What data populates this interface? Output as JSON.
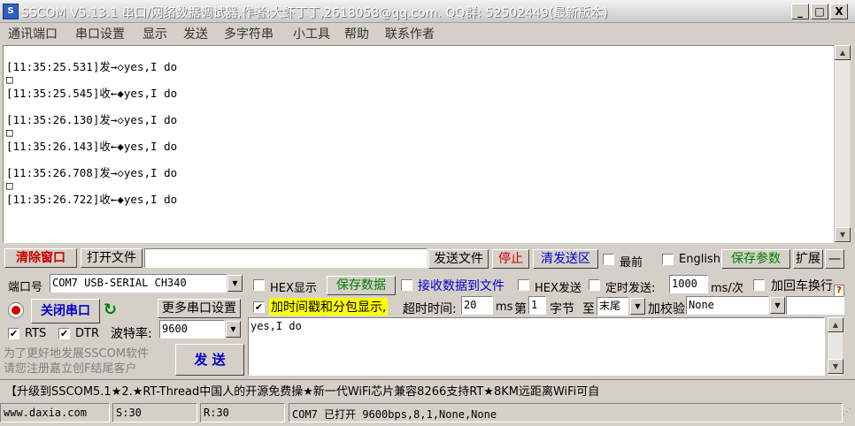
{
  "window": {
    "title": "SSCOM V5.13.1 串口/网络数据调试器,作者:大虾丁丁,2618058@qq.com. QQ群: 52502449(最新版本)",
    "minimize": "_",
    "maximize": "□",
    "close": "X"
  },
  "menu": [
    "通讯端口",
    "串口设置",
    "显示",
    "发送",
    "多字符串",
    "小工具",
    "帮助",
    "联系作者"
  ],
  "receive_log": [
    "[11:35:25.531]发→◇yes,I do",
    "□",
    "[11:35:25.545]收←◆yes,I do",
    "[11:35:26.130]发→◇yes,I do",
    "□",
    "[11:35:26.143]收←◆yes,I do",
    "[11:35:26.708]发→◇yes,I do",
    "□",
    "[11:35:26.722]收←◆yes,I do"
  ],
  "toolbar": {
    "clear_window": "清除窗口",
    "open_file": "打开文件",
    "file_path": "",
    "send_file": "发送文件",
    "stop": "停止",
    "clear_send": "清发送区",
    "topmost": "最前",
    "english": "English",
    "save_params": "保存参数",
    "expand": "扩展",
    "collapse": "—"
  },
  "port": {
    "label": "端口号",
    "value": "COM7 USB-SERIAL CH340",
    "close_port": "关闭串口",
    "more_settings": "更多串口设置",
    "rts": "RTS",
    "dtr": "DTR",
    "baud_label": "波特率:",
    "baud_value": "9600"
  },
  "options": {
    "hex_display": "HEX显示",
    "save_data": "保存数据",
    "recv_to_file": "接收数据到文件",
    "hex_send": "HEX发送",
    "timed_send": "定时发送:",
    "interval": "1000",
    "interval_unit": "ms/次",
    "append_crlf": "加回车换行",
    "timestamp": "加时间戳和分包显示,",
    "timeout_label": "超时时间:",
    "timeout_value": "20",
    "timeout_unit": "ms",
    "byte_prefix": "第",
    "byte_value": "1",
    "byte_suffix": "字节",
    "to_label": "至",
    "end_value": "末尾",
    "checksum_label": "加校验",
    "checksum_value": "None",
    "help": "?"
  },
  "send_text": "yes,I do",
  "promo": {
    "line1": "为了更好地发展SSCOM软件",
    "line2": "请您注册嘉立创F结尾客户",
    "send_button": "发  送"
  },
  "ticker": "【升级到SSCOM5.1★2.★RT-Thread中国人的开源免费操★新一代WiFi芯片兼容8266支持RT★8KM远距离WiFi可自",
  "status": {
    "website": "www.daxia.com",
    "sent": "S:30",
    "received": "R:30",
    "port_state": "COM7 已打开  9600bps,8,1,None,None"
  },
  "colors": {
    "red_label": "#cc0000",
    "green_label": "#008000",
    "blue_label": "#0000cc",
    "highlight": "#ffff00",
    "gray_promo": "#808080"
  }
}
